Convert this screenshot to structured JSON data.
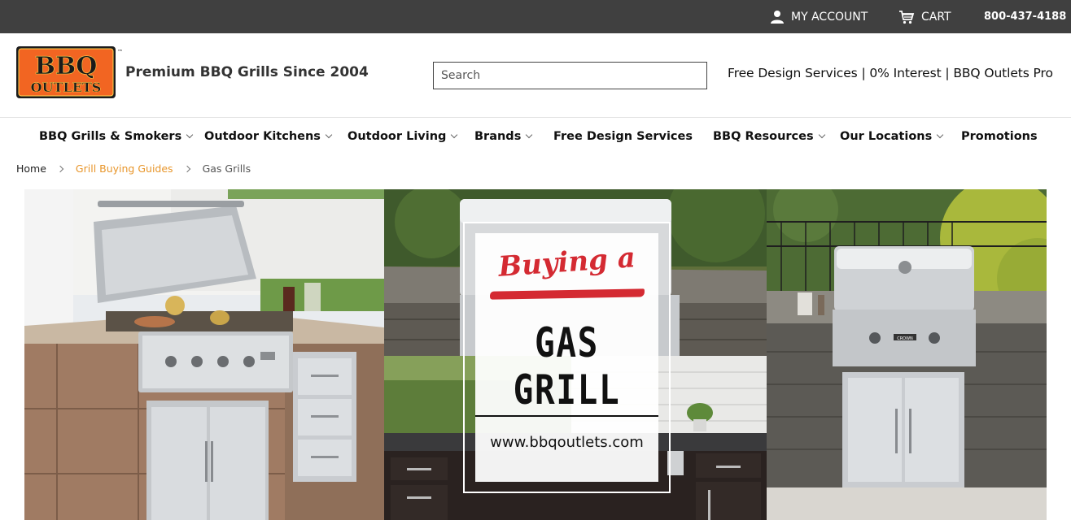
{
  "topbar": {
    "account_label": "MY ACCOUNT",
    "cart_label": "CART",
    "phone": "800-437-4188"
  },
  "header": {
    "logo_line1": "BBQ",
    "logo_line2": "OUTLETS",
    "logo_tm": "™",
    "tagline": "Premium BBQ Grills Since 2004",
    "search_placeholder": "Search",
    "links": [
      "Free Design Services",
      "0% Interest",
      "BBQ Outlets Pro"
    ],
    "link_separator": " | "
  },
  "nav": {
    "items": [
      {
        "label": "BBQ Grills & Smokers",
        "dropdown": true
      },
      {
        "label": "Outdoor Kitchens",
        "dropdown": true
      },
      {
        "label": "Outdoor Living",
        "dropdown": true
      },
      {
        "label": "Brands",
        "dropdown": true
      },
      {
        "label": "Free Design Services",
        "dropdown": false
      },
      {
        "label": "BBQ Resources",
        "dropdown": true
      },
      {
        "label": "Our Locations",
        "dropdown": true
      },
      {
        "label": "Promotions",
        "dropdown": false
      }
    ]
  },
  "breadcrumb": {
    "home": "Home",
    "guides": "Grill Buying Guides",
    "current": "Gas Grills"
  },
  "hero": {
    "script_text": "Buying a",
    "line1": "GAS",
    "line2": "GRILL",
    "url": "www.bbqoutlets.com",
    "badge_text": "CROWN"
  },
  "colors": {
    "topbar_bg": "#404040",
    "accent_orange": "#e8962b",
    "script_red": "#d42a32",
    "logo_orange": "#f26522"
  }
}
